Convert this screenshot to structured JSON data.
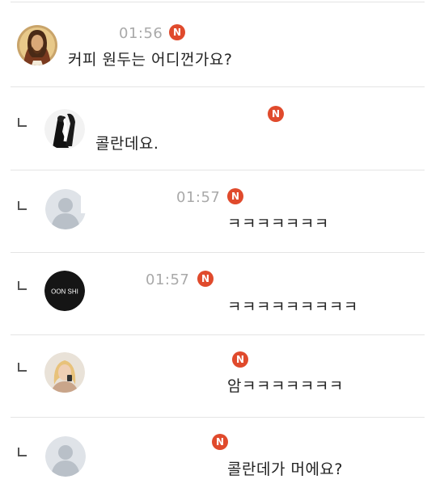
{
  "comments": [
    {
      "avatar": "jesus-portrait-avatar",
      "time": "01:56",
      "badge": "N",
      "text": "커피 원두는 어디껀가요?",
      "is_reply": false
    },
    {
      "avatar": "dark-figure-avatar",
      "time": "",
      "badge": "N",
      "text": "콜란데요.",
      "is_reply": true
    },
    {
      "avatar": "default-user-avatar",
      "time": "01:57",
      "badge": "N",
      "text": "ㅋㅋㅋㅋㅋㅋㅋ",
      "is_reply": true
    },
    {
      "avatar": "moon-shin-logo-avatar",
      "avatar_text": "OON SHI",
      "time": "01:57",
      "badge": "N",
      "text": "ㅋㅋㅋㅋㅋㅋㅋㅋㅋ",
      "is_reply": true
    },
    {
      "avatar": "blonde-person-avatar",
      "time": "",
      "badge": "N",
      "text": "암ㅋㅋㅋㅋㅋㅋㅋ",
      "is_reply": true
    },
    {
      "avatar": "default-user-avatar",
      "time": "",
      "badge": "N",
      "text": "콜란데가 머에요?",
      "is_reply": true
    }
  ],
  "colors": {
    "badge": "#e04a2c",
    "time": "#a9a9a9",
    "text": "#222222",
    "divider": "#e4e4e4"
  }
}
